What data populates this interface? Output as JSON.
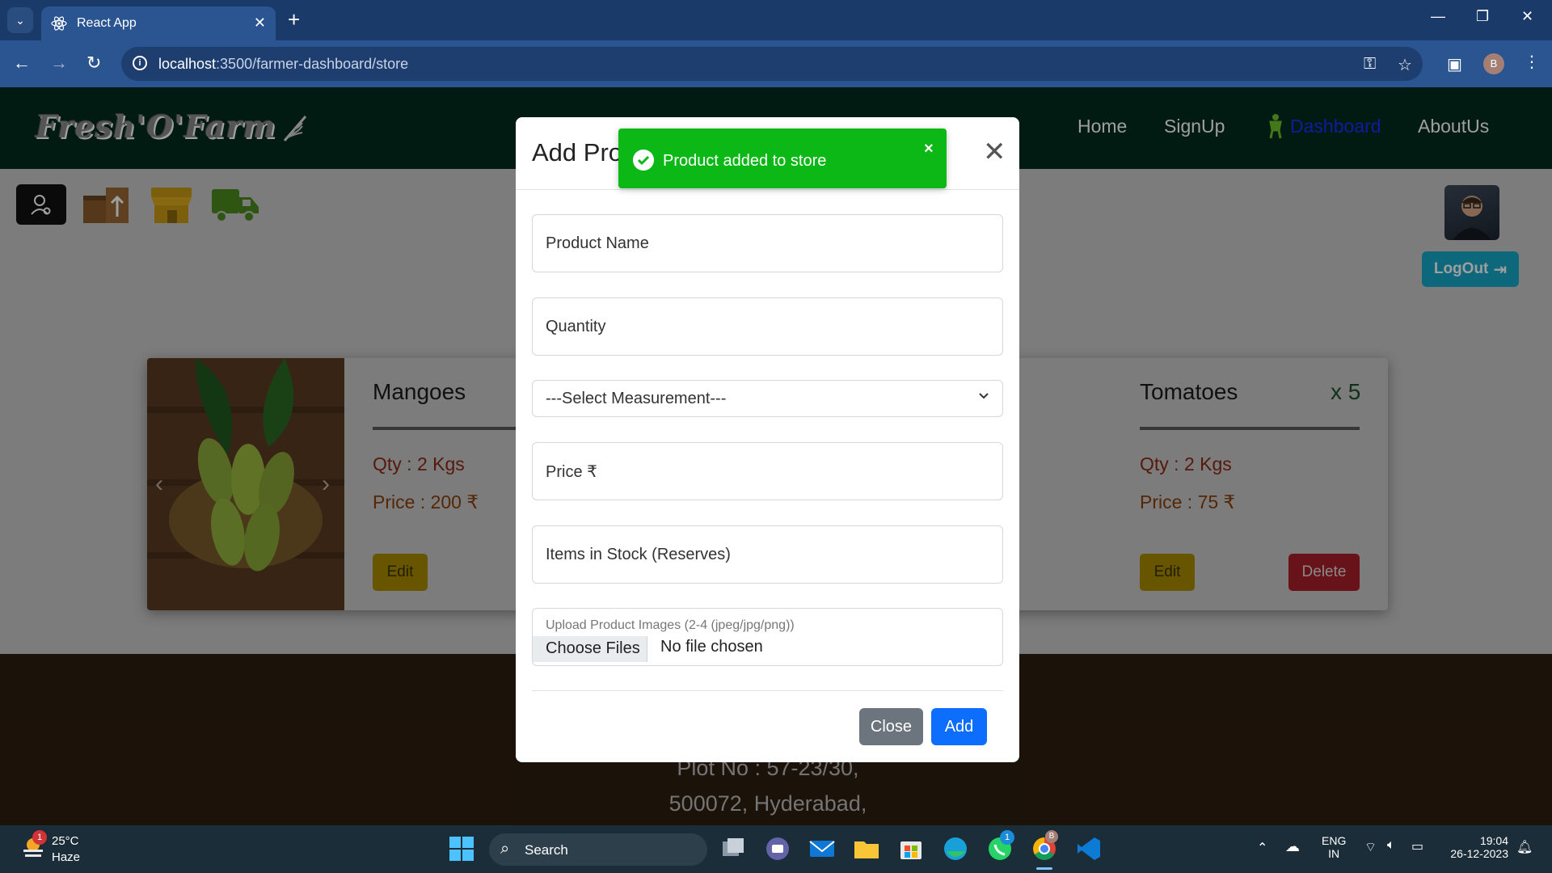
{
  "browser": {
    "tab_title": "React App",
    "url_host": "localhost",
    "url_rest": ":3500/farmer-dashboard/store",
    "profile_initial": "B"
  },
  "app": {
    "brand": "Fresh'O'Farm",
    "nav": {
      "home": "Home",
      "signup": "SignUp",
      "dashboard": "Dashboard",
      "about": "AboutUs"
    },
    "logout_label": "LogOut"
  },
  "products": [
    {
      "name": "Mangoes",
      "qty": "Qty : 2 Kgs",
      "price": "Price : 200 ₹",
      "edit_label": "Edit"
    },
    {
      "name": "Tomatoes",
      "count": "x 5",
      "qty": "Qty : 2 Kgs",
      "price": "Price : 75 ₹",
      "edit_label": "Edit",
      "delete_label": "Delete"
    }
  ],
  "footer": {
    "line1": "Plot No : 57-23/30,",
    "line2": "500072, Hyderabad,"
  },
  "modal": {
    "title": "Add Product",
    "fields": {
      "name_placeholder": "Product Name",
      "quantity_placeholder": "Quantity",
      "measurement_selected": "---Select Measurement---",
      "price_placeholder": "Price ₹",
      "stock_placeholder": "Items in Stock (Reserves)",
      "upload_label": "Upload Product Images (2-4 (jpeg/jpg/png))",
      "file_button": "Choose Files",
      "file_status": "No file chosen"
    },
    "close_label": "Close",
    "add_label": "Add"
  },
  "toast": {
    "message": "Product added to store"
  },
  "taskbar": {
    "weather_temp": "25°C",
    "weather_desc": "Haze",
    "weather_badge": "1",
    "search_label": "Search",
    "whatsapp_badge": "1",
    "chrome_badge": "B",
    "lang_line1": "ENG",
    "lang_line2": "IN",
    "time": "19:04",
    "date": "26-12-2023"
  },
  "colors": {
    "navbar": "#032d1f",
    "toast": "#0bb815",
    "primary": "#0d6efd",
    "secondary": "#6c757d",
    "logout": "#17a9c8"
  }
}
